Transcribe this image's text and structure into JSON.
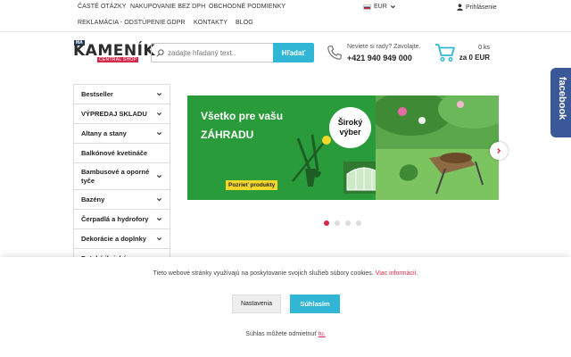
{
  "topbar": {
    "links_row1": [
      "ČASTÉ OTÁZKY",
      "NAKUPOVANIE BEZ DPH",
      "OBCHODNÉ PODMIENKY"
    ],
    "links_row2": [
      "REKLAMÁCIA - ODSTÚPENIE",
      "GDPR",
      "KONTAKTY",
      "BLOG"
    ],
    "currency": "EUR",
    "login": "Prihlásenie"
  },
  "header": {
    "logo": {
      "prefix": "MA",
      "name": "KAMENÍK",
      "tagline": "CENTRAL SHOP"
    },
    "search": {
      "placeholder": "zadajte hľadaný text..",
      "button": "Hľadať"
    },
    "contact": {
      "question": "Neviete si rady? Zavolajte.",
      "phone": "+421 940 949 000"
    },
    "cart": {
      "count": "0 ks",
      "total": "za 0 EUR"
    }
  },
  "facebook_tab": {
    "label": "facebook"
  },
  "sidebar": {
    "items": [
      {
        "label": "Bestseller",
        "chevron": true
      },
      {
        "label": "VÝPREDAJ SKLADU",
        "chevron": true
      },
      {
        "label": "Altany a stany",
        "chevron": true
      },
      {
        "label": "Balkónové kvetináče",
        "chevron": false
      },
      {
        "label": "Bambusové a oporné tyče",
        "chevron": true
      },
      {
        "label": "Bazény",
        "chevron": true
      },
      {
        "label": "Čerpadlá a hydrofory",
        "chevron": true
      },
      {
        "label": "Dekorácie a doplnky",
        "chevron": true
      },
      {
        "label": "Detské ihriská",
        "chevron": true
      }
    ]
  },
  "banner": {
    "line1": "Všetko pre vašu",
    "line2": "ZÁHRADU",
    "badge": "Široký výber",
    "cta": "Pozrieť produkty",
    "slides": 4,
    "active_slide": 1
  },
  "cookie": {
    "text": "Tieto webové stránky využívajú na poskytovanie svojich služieb súbory cookies.",
    "more_link": "Viac informácií.",
    "settings_button": "Nastavenia",
    "agree_button": "Súhlasím",
    "revoke_text": "Súhlas môžete odmietnuť",
    "revoke_link": "tu."
  },
  "colors": {
    "accent": "#31b7d5",
    "brand": "#d6294a",
    "banner_green": "#2a9b3a",
    "facebook": "#3b5998"
  }
}
